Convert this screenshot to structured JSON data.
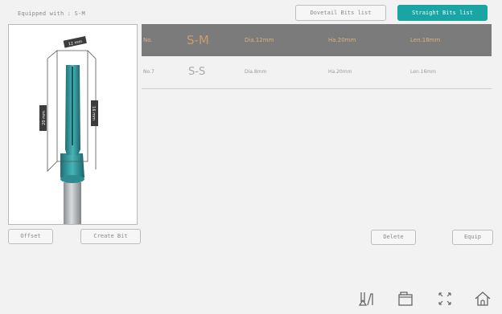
{
  "header": {
    "equipped": "Equipped with : S-M",
    "dovetail_label": "Dovetail Bits list",
    "straight_label": "Straight Bits list"
  },
  "preview": {
    "dim_top": "12 mm",
    "dim_left": "20 mm",
    "dim_right": "16 mm"
  },
  "table": {
    "headers": [
      "No.",
      "S-M",
      "Dia.12mm",
      "Ha.20mm",
      "Len.18mm"
    ],
    "rows": [
      [
        "No.7",
        "S-S",
        "Dia.8mm",
        "Ha.20mm",
        "Len.16mm"
      ]
    ]
  },
  "actions": {
    "offset": "Offset",
    "create": "Create Bit",
    "delete": "Delete",
    "equip": "Equip"
  },
  "colors": {
    "accent": "#1aa4a4",
    "header_bg": "#7b7b7b",
    "header_text": "#d9b380"
  }
}
